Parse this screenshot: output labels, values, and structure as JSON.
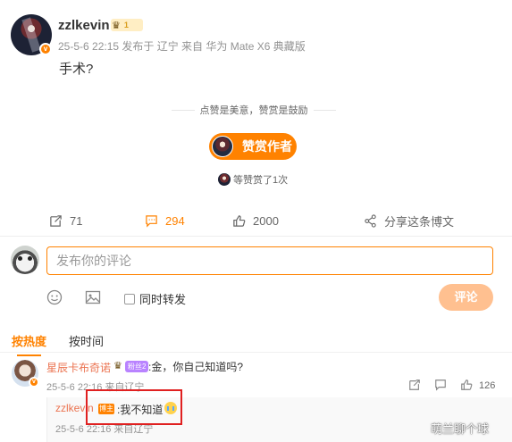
{
  "post": {
    "username": "zzlkevin",
    "member_level": "1",
    "meta": "25-5-6 22:15  发布于 辽宁  来自 华为 Mate X6 典藏版",
    "text": "手术?"
  },
  "reward": {
    "slogan": "点赞是美意，赞赏是鼓励",
    "button_label": "赞赏作者",
    "count_text": "等赞赏了1次"
  },
  "actions": {
    "forward_count": "71",
    "comment_count": "294",
    "like_count": "2000",
    "share_label": "分享这条博文"
  },
  "composer": {
    "placeholder": "发布你的评论",
    "repost_label": "同时转发",
    "submit_label": "评论"
  },
  "sort": {
    "hot_label": "按热度",
    "time_label": "按时间"
  },
  "comments": [
    {
      "username": "星辰卡布奇诺",
      "badge": "粉丝2",
      "text": ":金，你自己知道吗?",
      "meta": "25-5-6 22:16  来自辽宁",
      "like_count": "126",
      "reply": {
        "username": "zzlkevin",
        "badge": "博主",
        "text": ":我不知道",
        "meta": "25-5-6 22:16  来自辽宁"
      }
    }
  ],
  "watermark": "萌兰聊个球",
  "colors": {
    "accent": "#ff8200",
    "link": "#eb7350",
    "highlight": "#e02020"
  }
}
